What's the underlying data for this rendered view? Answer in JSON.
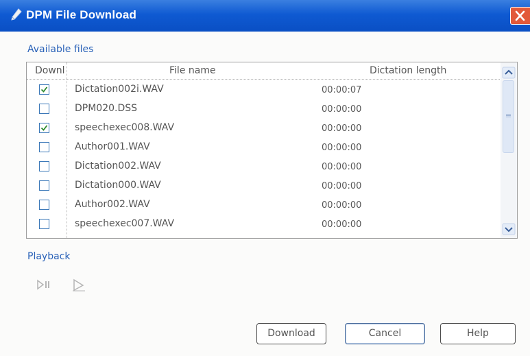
{
  "window": {
    "title": "DPM File Download"
  },
  "available_files": {
    "label": "Available files",
    "columns": {
      "download": "Downl",
      "file_name": "File name",
      "dictation_length": "Dictation length"
    },
    "rows": [
      {
        "checked": true,
        "file_name": "Dictation002i.WAV",
        "length": "00:00:07"
      },
      {
        "checked": false,
        "file_name": "DPM020.DSS",
        "length": "00:00:00"
      },
      {
        "checked": true,
        "file_name": "speechexec008.WAV",
        "length": "00:00:00"
      },
      {
        "checked": false,
        "file_name": "Author001.WAV",
        "length": "00:00:00"
      },
      {
        "checked": false,
        "file_name": "Dictation002.WAV",
        "length": "00:00:00"
      },
      {
        "checked": false,
        "file_name": "Dictation000.WAV",
        "length": "00:00:00"
      },
      {
        "checked": false,
        "file_name": "Author002.WAV",
        "length": "00:00:00"
      },
      {
        "checked": false,
        "file_name": "speechexec007.WAV",
        "length": "00:00:00"
      }
    ]
  },
  "playback": {
    "label": "Playback",
    "icons": [
      "play-pause-icon",
      "play-icon"
    ]
  },
  "buttons": {
    "download": "Download",
    "cancel": "Cancel",
    "help": "Help"
  },
  "colors": {
    "title_bar": "#0f5ad2",
    "close_button": "#e2593a",
    "section_label": "#2a62b8",
    "checkbox_border": "#3b78b8",
    "checkmark": "#2d8a2d"
  }
}
